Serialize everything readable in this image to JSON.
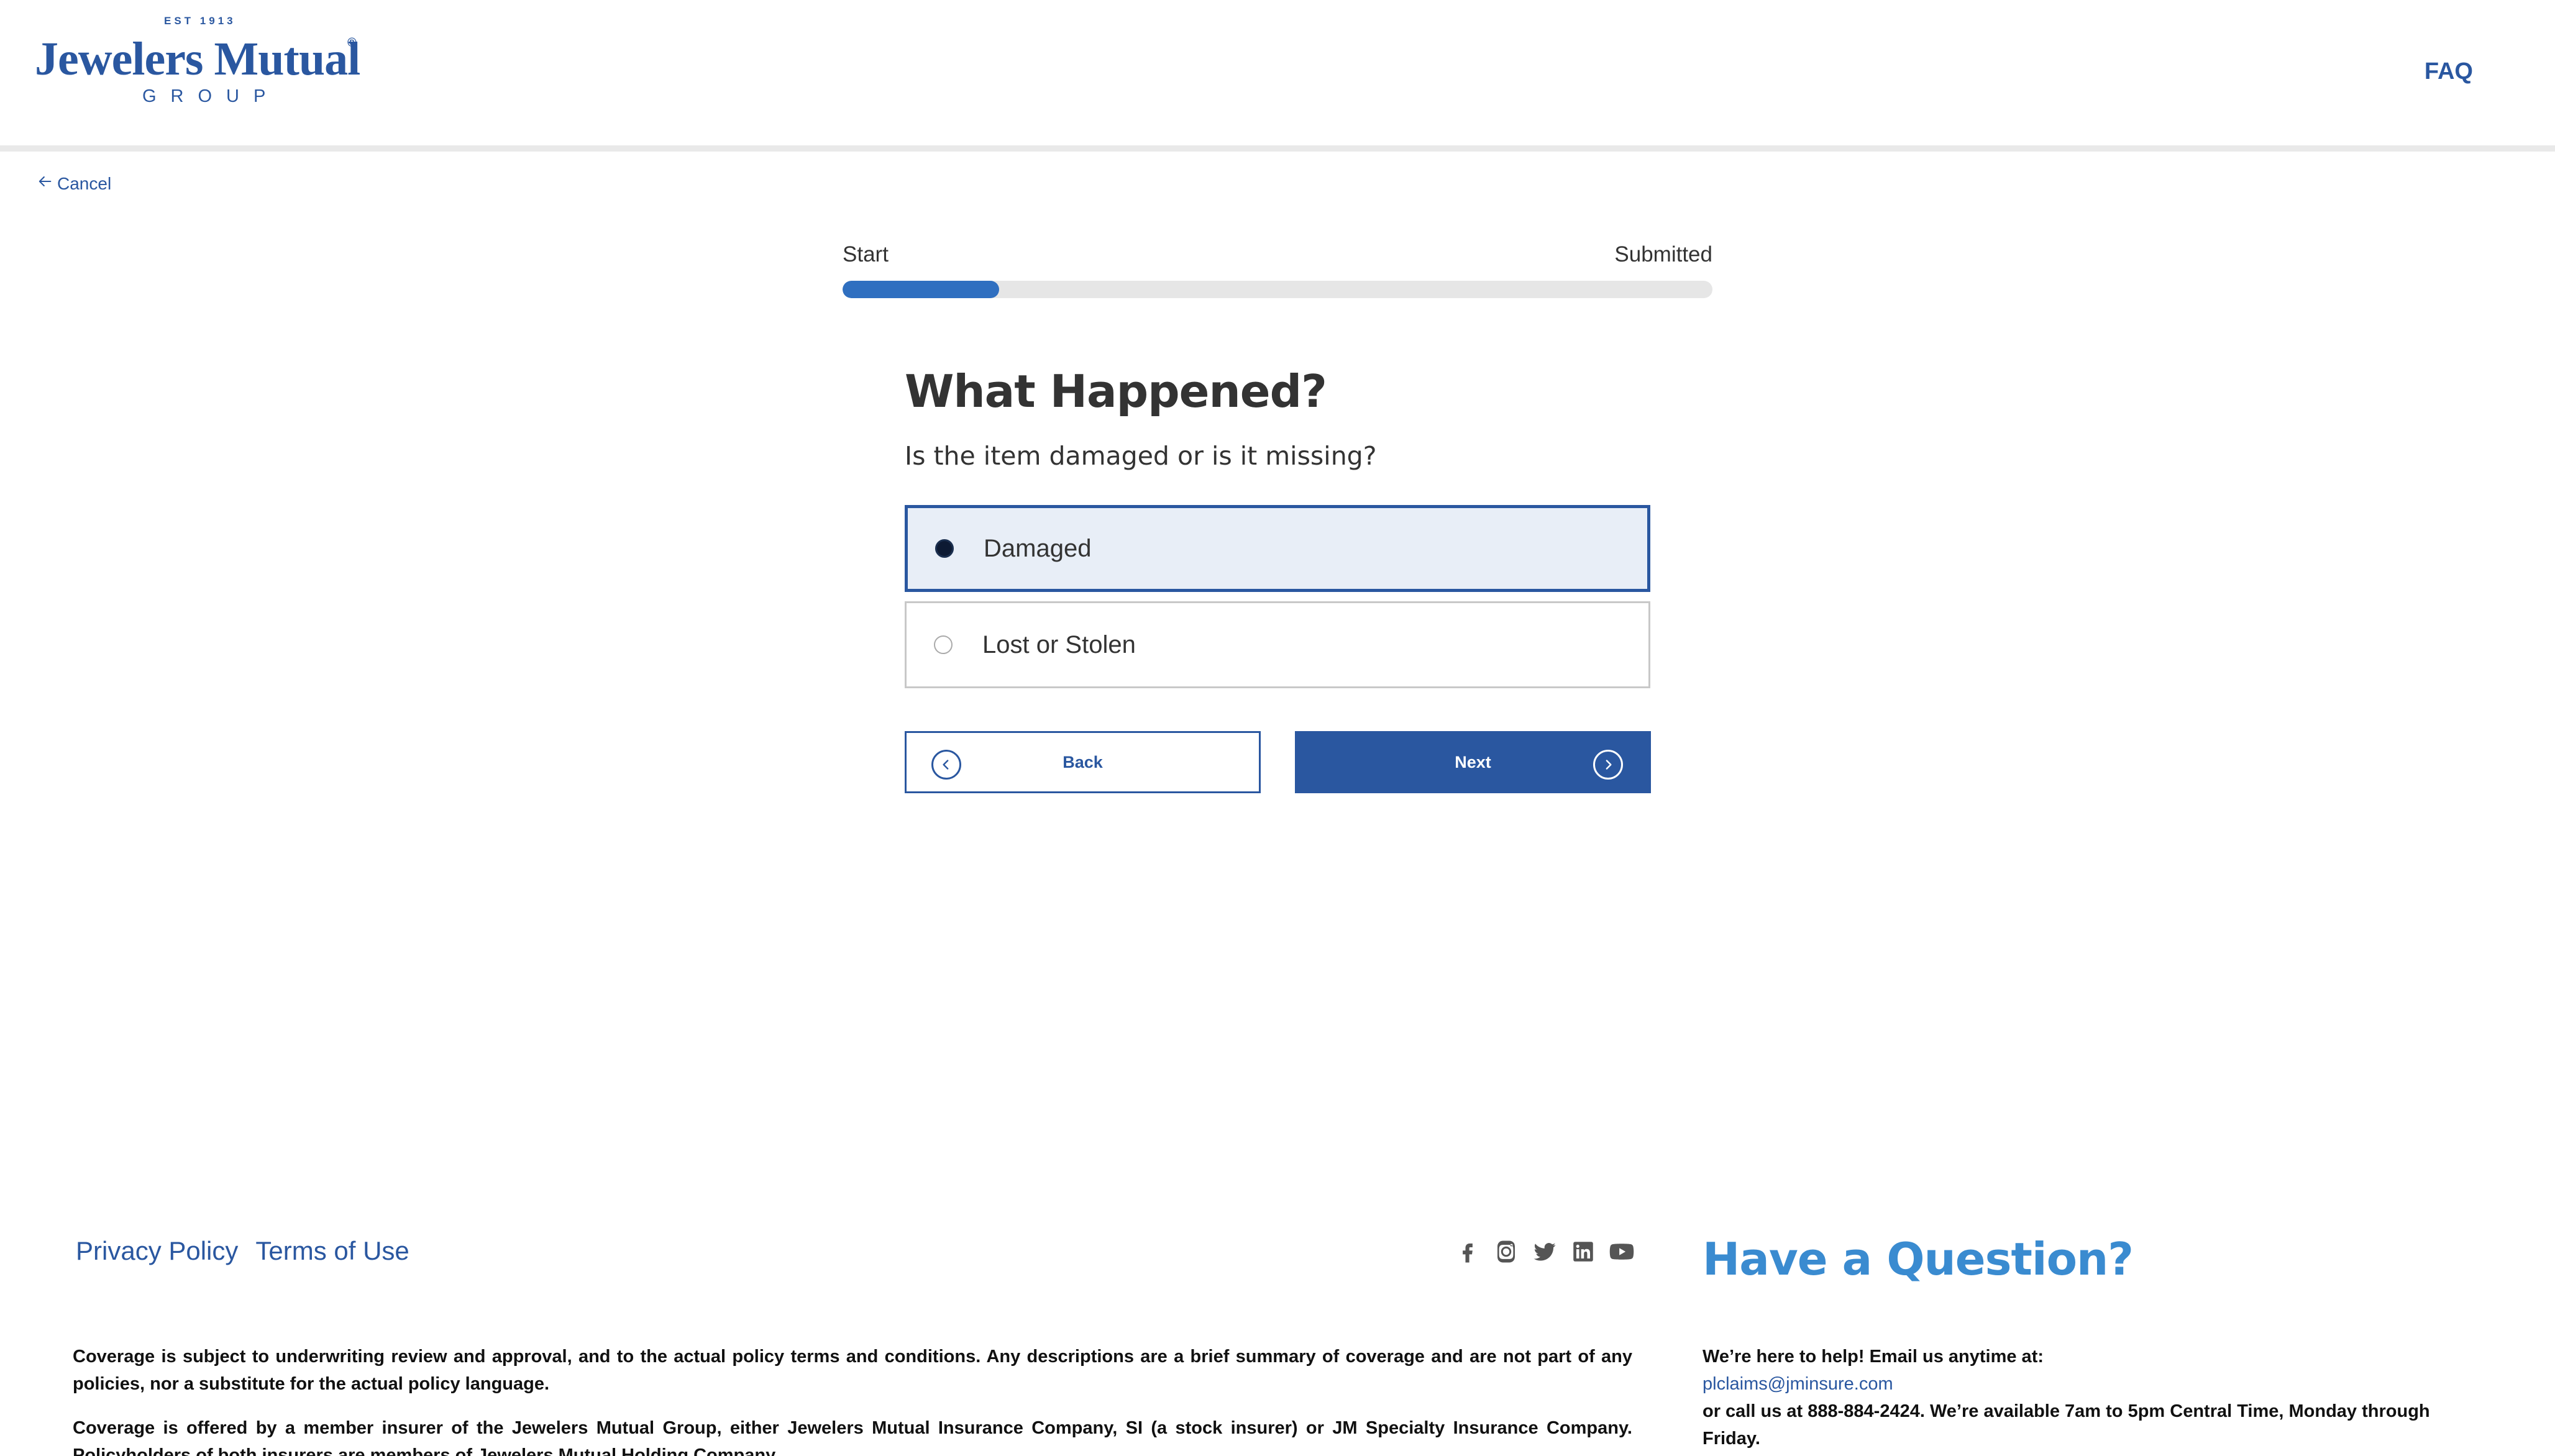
{
  "header": {
    "logo": {
      "est": "EST 1913",
      "name": "Jewelers Mutual",
      "reg": "®",
      "group": "GROUP"
    },
    "faq_label": "FAQ"
  },
  "nav": {
    "cancel_label": "Cancel"
  },
  "progress": {
    "start_label": "Start",
    "end_label": "Submitted",
    "fraction": 0.18
  },
  "question": {
    "title": "What Happened?",
    "subtitle": "Is the item damaged or is it missing?",
    "options": [
      {
        "label": "Damaged",
        "selected": true
      },
      {
        "label": "Lost or Stolen",
        "selected": false
      }
    ]
  },
  "buttons": {
    "back_label": "Back",
    "next_label": "Next"
  },
  "footer": {
    "links": [
      "Privacy Policy",
      "Terms of Use"
    ],
    "social_icons": [
      "facebook-icon",
      "instagram-icon",
      "twitter-icon",
      "linkedin-icon",
      "youtube-icon"
    ],
    "legal": [
      "Coverage is subject to underwriting review and approval, and to the actual policy terms and conditions. Any descriptions are a brief summary of coverage and are not part of any policies, nor a substitute for the actual policy language.",
      "Coverage is offered by a member insurer of the Jewelers Mutual Group, either Jewelers Mutual Insurance Company, SI (a stock insurer) or JM Specialty Insurance Company. Policyholders of both insurers are members of Jewelers Mutual Holding Company."
    ],
    "question_title": "Have a Question?",
    "help_intro": "We’re here to help! Email us anytime at:",
    "help_email": "plclaims@jminsure.com",
    "help_call_prefix": "or call us at ",
    "help_phone": "888-884-2424",
    "help_call_suffix": ". We’re available 7am to 5pm Central Time, Monday through Friday."
  },
  "colors": {
    "brand": "#2a57a0",
    "accent": "#2f6fc0",
    "question_heading": "#3a8bd0",
    "selected_bg": "#e8eef7"
  }
}
